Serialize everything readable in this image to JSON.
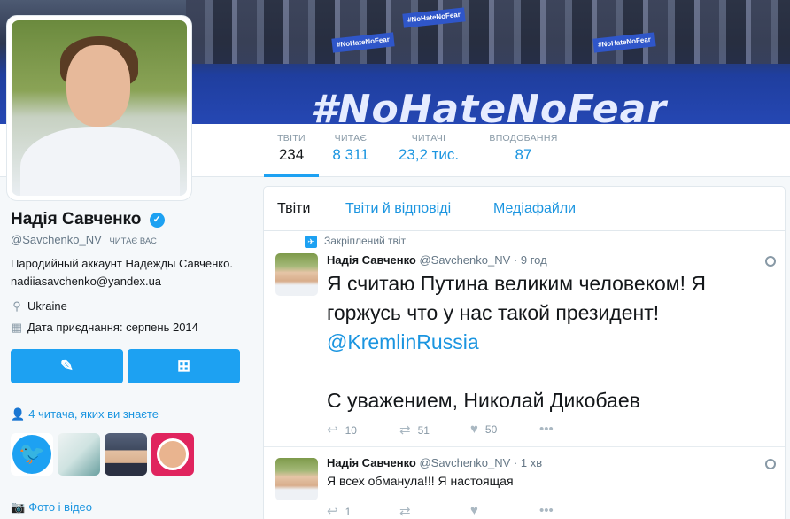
{
  "banner": {
    "slogan": "#NoHateNoFear",
    "sign_text": "#NoHateNoFear"
  },
  "stats": [
    {
      "label": "Твіти",
      "value": "234"
    },
    {
      "label": "Читає",
      "value": "8 311"
    },
    {
      "label": "Читачі",
      "value": "23,2 тис."
    },
    {
      "label": "Вподобання",
      "value": "87"
    }
  ],
  "profile": {
    "name": "Надія Савченко",
    "handle": "@Savchenko_NV",
    "follows_you": "ЧИТАЄ ВАС",
    "bio": "Пародийный аккаунт Надежды Савченко. nadiiasavchenko@yandex.ua",
    "location": "Ukraine",
    "joined": "Дата приєднання: серпень 2014",
    "followers_known": "4 читача, яких ви знаєте",
    "photos_label": "Фото і відео"
  },
  "tabs": [
    "Твіти",
    "Твіти й відповіді",
    "Медіафайли"
  ],
  "tweets": [
    {
      "pinned_label": "Закріплений твіт",
      "name": "Надія Савченко",
      "handle": "@Savchenko_NV",
      "time": "· 9 год",
      "text_1": "Я считаю Путина великим человеком! Я горжусь что у нас такой президент!",
      "mention": "@KremlinRussia",
      "text_2": "С уважением, Николай Дикобаев",
      "replies": "10",
      "retweets": "51",
      "likes": "50"
    },
    {
      "name": "Надія Савченко",
      "handle": "@Savchenko_NV",
      "time": "· 1 хв",
      "text": "Я всех обманула!!! Я настоящая",
      "replies": "1",
      "retweets": "",
      "likes": ""
    }
  ],
  "colors": {
    "accent": "#1da1f2",
    "link": "#1b95e0"
  },
  "icons": [
    "verified-icon",
    "location-icon",
    "calendar-icon",
    "reply-icon",
    "retweet-icon",
    "like-icon",
    "more-icon",
    "globe-icon",
    "pin-icon",
    "camera-icon",
    "user-icon"
  ]
}
